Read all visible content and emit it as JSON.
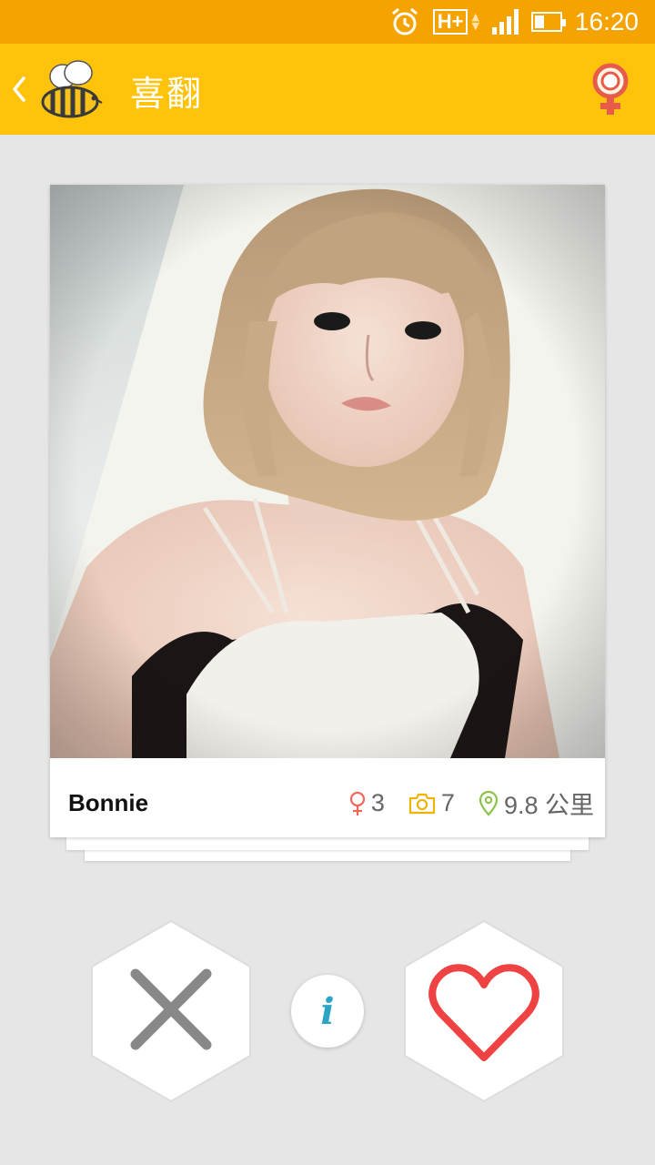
{
  "status_bar": {
    "time": "16:20",
    "network": "H+",
    "icons": [
      "alarm-icon",
      "network-h-plus-icon",
      "signal-icon",
      "battery-icon"
    ]
  },
  "app_bar": {
    "title": "喜翻",
    "icons": [
      "back-icon",
      "bee-logo-icon",
      "female-gender-filter-icon"
    ]
  },
  "card": {
    "name": "Bonnie",
    "gender_count": "3",
    "photo_count": "7",
    "distance": "9.8 公里",
    "icons": [
      "female-icon",
      "camera-icon",
      "location-pin-icon"
    ]
  },
  "actions": {
    "pass_icon": "close-x-icon",
    "info_label": "i",
    "like_icon": "heart-icon"
  },
  "colors": {
    "status_bar": "#f5a300",
    "app_bar": "#ffc30b",
    "background": "#e6e6e6",
    "female": "#f2675a",
    "camera": "#f0b400",
    "location": "#8bc34a",
    "heart": "#ef4242",
    "info": "#2aa5c6",
    "pass": "#888888"
  }
}
